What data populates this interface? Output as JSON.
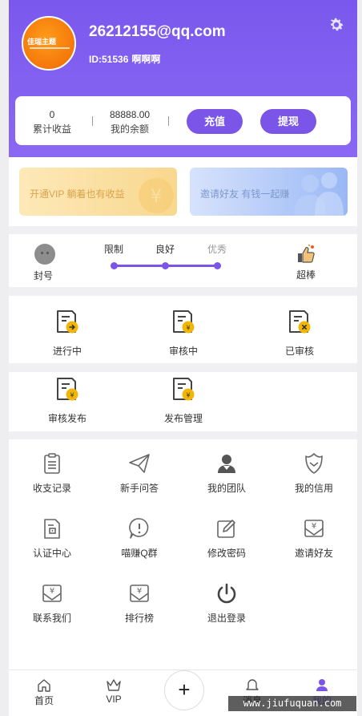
{
  "header": {
    "avatar_text": "佳瑞主题",
    "email": "26212155@qq.com",
    "user_id": "ID:51536",
    "nickname": "啊啊啊",
    "settings_icon": "gear-icon"
  },
  "wallet": {
    "earnings_value": "0",
    "earnings_label": "累计收益",
    "balance_value": "88888.00",
    "balance_label": "我的余额",
    "recharge_label": "充值",
    "withdraw_label": "提现"
  },
  "promos": {
    "vip_label": "开通VIP 躺着也有收益",
    "invite_label": "邀请好友 有钱一起赚"
  },
  "credit_level": {
    "left_label": "封号",
    "levels": [
      "限制",
      "良好",
      "优秀"
    ],
    "right_label": "超棒"
  },
  "task_status": {
    "in_progress": "进行中",
    "reviewing": "审核中",
    "reviewed": "已审核",
    "review_publish": "审核发布",
    "publish_manage": "发布管理"
  },
  "menu": {
    "items": [
      {
        "label": "收支记录",
        "icon": "clipboard-icon"
      },
      {
        "label": "新手问答",
        "icon": "paper-plane-icon"
      },
      {
        "label": "我的团队",
        "icon": "team-icon"
      },
      {
        "label": "我的信用",
        "icon": "badge-icon"
      },
      {
        "label": "认证中心",
        "icon": "certificate-icon"
      },
      {
        "label": "喵赚Q群",
        "icon": "alert-bubble-icon"
      },
      {
        "label": "修改密码",
        "icon": "edit-icon"
      },
      {
        "label": "邀请好友",
        "icon": "yen-envelope-icon"
      },
      {
        "label": "联系我们",
        "icon": "yen-envelope-icon"
      },
      {
        "label": "排行榜",
        "icon": "yen-envelope-icon"
      },
      {
        "label": "退出登录",
        "icon": "power-icon"
      }
    ]
  },
  "tabbar": {
    "home": "首页",
    "vip": "VIP",
    "plus": "+",
    "messages": "消息",
    "mine": "我的"
  },
  "colors": {
    "accent": "#7b55e8",
    "header_bg": "#7a58ee",
    "coin": "#f2b705"
  },
  "watermark": "www.jiufuquan.com"
}
